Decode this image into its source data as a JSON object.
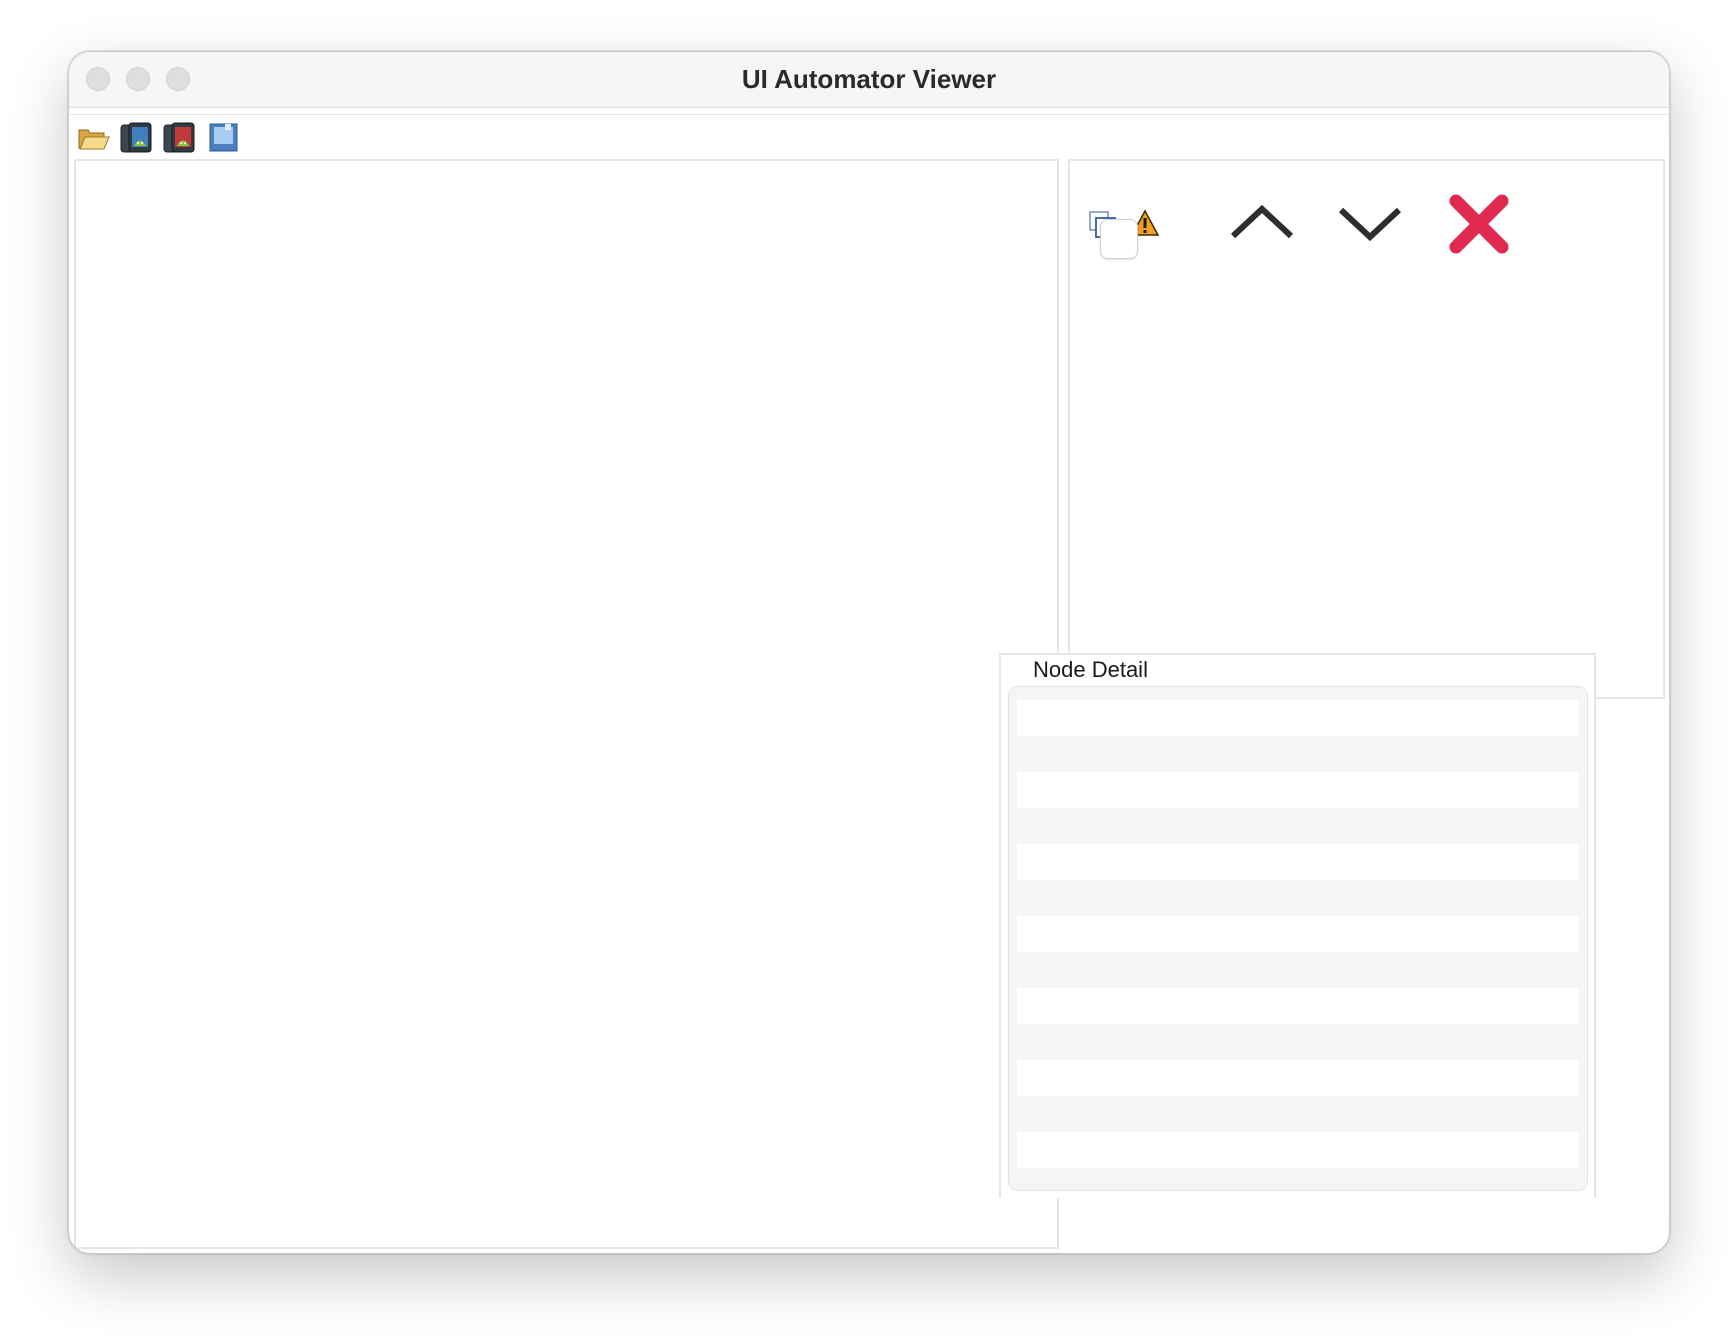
{
  "window": {
    "title": "UI Automator Viewer"
  },
  "toolbar": {
    "items": [
      {
        "icon": "open-folder-icon"
      },
      {
        "icon": "device-screenshot-icon"
      },
      {
        "icon": "device-screenshot-compressed-icon"
      },
      {
        "icon": "save-icon"
      }
    ]
  },
  "tree_toolbar": {
    "items": [
      {
        "icon": "expand-all-icon"
      },
      {
        "icon": "warning-icon"
      },
      {
        "icon": "checkbox"
      },
      {
        "icon": "chevron-up-icon"
      },
      {
        "icon": "chevron-down-icon"
      },
      {
        "icon": "close-icon"
      }
    ]
  },
  "node_detail": {
    "title": "Node Detail"
  },
  "colors": {
    "close": "#e0294f",
    "warning": "#f0a020",
    "chevron": "#2e2e2e"
  }
}
